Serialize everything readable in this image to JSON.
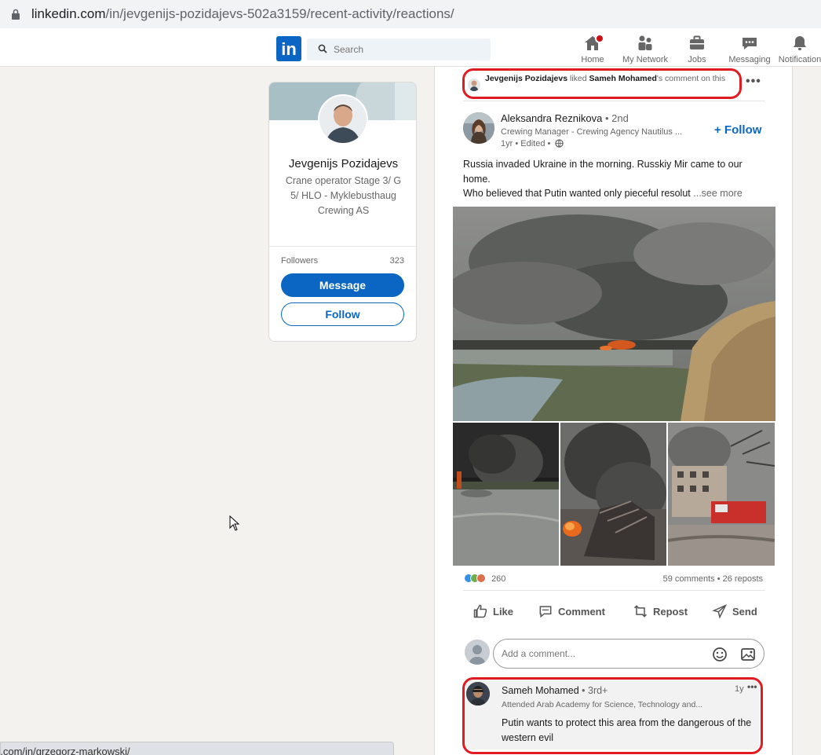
{
  "browser": {
    "url_host": "linkedin.com",
    "url_path": "/in/jevgenijs-pozidajevs-502a3159/recent-activity/reactions/",
    "status_link": "n.com/in/grzegorz-markowski/"
  },
  "nav": {
    "logo": "in",
    "search_placeholder": "Search",
    "items": [
      {
        "label": "Home",
        "icon": "home-icon"
      },
      {
        "label": "My Network",
        "icon": "network-icon"
      },
      {
        "label": "Jobs",
        "icon": "briefcase-icon"
      },
      {
        "label": "Messaging",
        "icon": "messaging-icon"
      },
      {
        "label": "Notification",
        "icon": "bell-icon"
      }
    ]
  },
  "profile": {
    "name": "Jevgenijs Pozidajevs",
    "headline": "Crane operator Stage 3/ G 5/ HLO - Myklebusthaug Crewing AS",
    "followers_label": "Followers",
    "followers_count": "323",
    "message_label": "Message",
    "follow_label": "Follow"
  },
  "activity": {
    "actor": "Jevgenijs Pozidajevs",
    "verb": " liked ",
    "target": "Sameh Mohamed",
    "suffix": "'s comment on this"
  },
  "post": {
    "author": "Aleksandra Reznikova",
    "degree": " • 2nd",
    "author_title": "Crewing Manager - Crewing Agency Nautilus ...",
    "meta": "1yr • Edited •",
    "follow_label": "+ Follow",
    "text_line1": "Russia invaded Ukraine in the morning. Russkiy Mir came to our home.",
    "text_line2": "Who believed that Putin wanted only pieceful resolut",
    "see_more": "...see more",
    "reactions_count": "260",
    "stats": "59 comments • 26 reposts",
    "actions": [
      "Like",
      "Comment",
      "Repost",
      "Send"
    ],
    "comment_placeholder": "Add a comment..."
  },
  "comment": {
    "author": "Sameh Mohamed",
    "degree": " • 3rd+",
    "time": "1y",
    "title": "Attended Arab Academy for Science, Technology and...",
    "text": "Putin wants to protect this area from the dangerous of the western evil"
  },
  "colors": {
    "brand": "#0a66c2",
    "highlight": "#e11b22",
    "notification_badge": "#cc1016"
  }
}
